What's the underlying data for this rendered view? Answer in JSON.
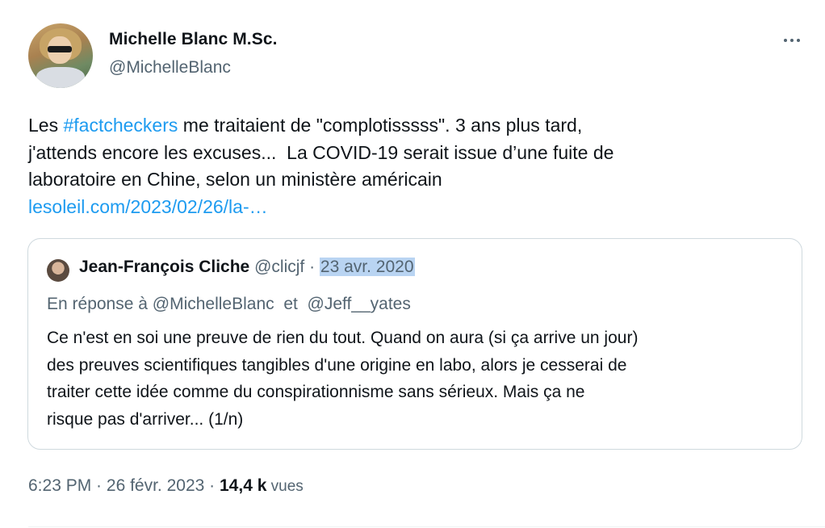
{
  "author": {
    "name": "Michelle Blanc M.Sc.",
    "handle": "@MichelleBlanc"
  },
  "tweet": {
    "line1_prefix": "Les ",
    "hashtag": "#factcheckers",
    "line1_suffix": " me traitaient de \"complotisssss\". 3 ans plus tard,",
    "line2": "j'attends encore les excuses...  La COVID-19 serait issue d’une fuite de",
    "line3": "laboratoire en Chine, selon un ministère américain",
    "link": "lesoleil.com/2023/02/26/la-…"
  },
  "quoted": {
    "name": "Jean-François Cliche",
    "handle": "@clicjf",
    "separator": " · ",
    "date": "23 avr. 2020",
    "reply_prefix": "En réponse à ",
    "reply_user1": "@MichelleBlanc",
    "reply_and": "  et  ",
    "reply_user2": "@Jeff__yates",
    "lines": [
      "Ce n'est en soi une preuve de rien du tout. Quand on aura (si ça arrive un jour)",
      "des preuves scientifiques tangibles d'une origine en labo, alors je cesserai de",
      "traiter cette idée comme du conspirationnisme sans sérieux. Mais ça ne",
      "risque pas d'arriver... (1/n)"
    ]
  },
  "meta": {
    "time": "6:23 PM",
    "dot": " · ",
    "date": "26 févr. 2023",
    "dot2": " · ",
    "views_count": "14,4 k",
    "views_label": " vues"
  },
  "icons": {
    "more": "more-horizontal-icon"
  },
  "colors": {
    "link": "#1d9bf0",
    "secondary": "#536471",
    "date_highlight": "#b9d4f2"
  }
}
